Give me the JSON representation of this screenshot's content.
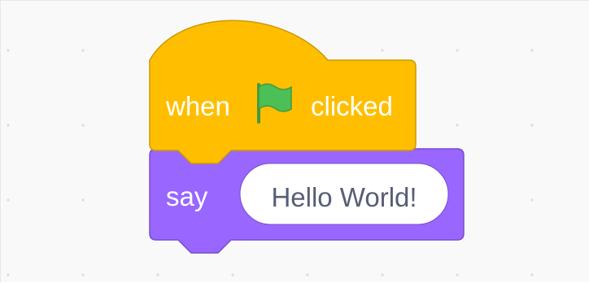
{
  "workspace": {
    "background": "#f9f9f9",
    "grid_dot_color": "#dddddd"
  },
  "script": {
    "hat_block": {
      "opcode": "when flag clicked",
      "category": "events",
      "color": "#ffbf00",
      "border_color": "#cc9900",
      "label_before": "when",
      "icon": "green-flag-icon",
      "icon_color": "#4cbf56",
      "label_after": "clicked"
    },
    "say_block": {
      "opcode": "say",
      "category": "looks",
      "color": "#9966ff",
      "border_color": "#774dcb",
      "label": "say",
      "input_value": "Hello World!"
    }
  }
}
